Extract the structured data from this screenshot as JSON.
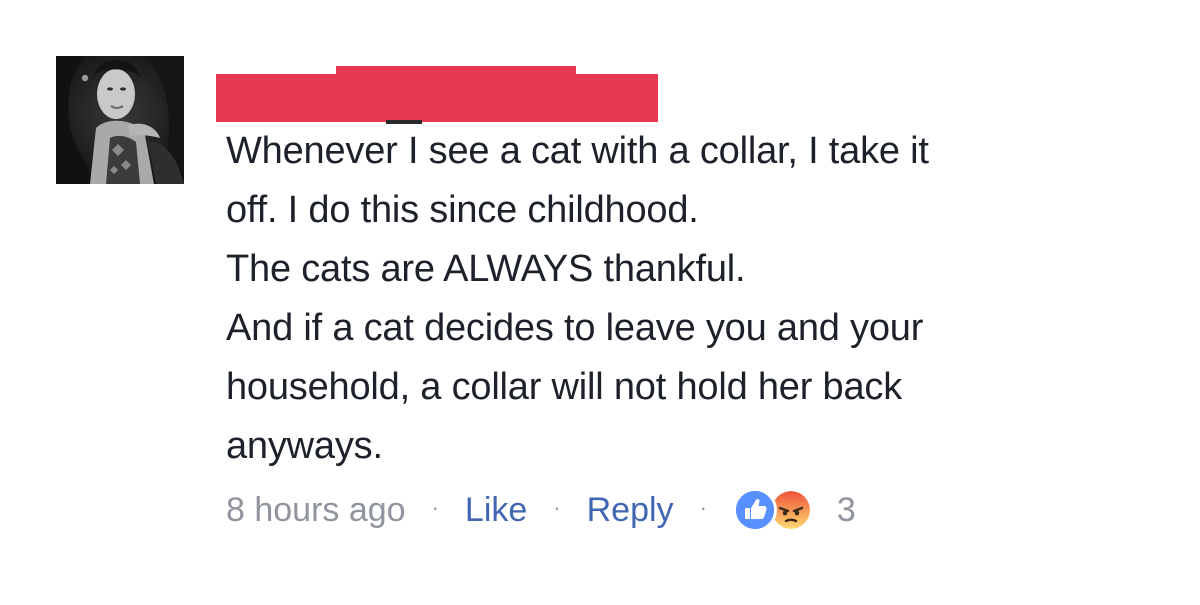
{
  "comment": {
    "lines": [
      "Whenever I see a cat with a collar, I take it",
      "off. I do this since childhood.",
      "The cats are ALWAYS thankful.",
      "And if a cat decides to leave you and your",
      "household, a collar will not hold her back",
      "anyways."
    ],
    "timestamp": "8 hours ago",
    "like_label": "Like",
    "reply_label": "Reply",
    "separator": "·",
    "reaction_count": "3",
    "reactions": [
      "like-icon",
      "angry-icon"
    ]
  },
  "colors": {
    "text": "#1d2129",
    "meta": "#90949c",
    "link": "#4267b2",
    "redaction": "#e8384f",
    "like_blue": "#5890ff",
    "angry_top": "#f0513a",
    "angry_bottom": "#ffd972"
  },
  "icons": {
    "avatar": "profile-photo",
    "redaction": "red-redaction-bar"
  }
}
